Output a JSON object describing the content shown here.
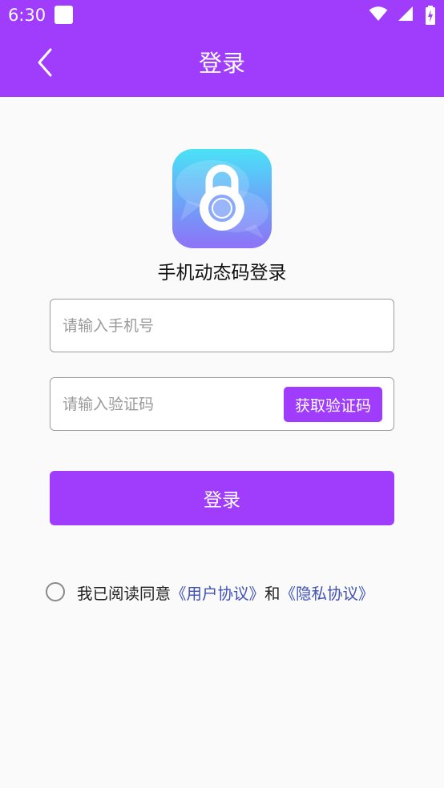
{
  "status_bar": {
    "time": "6:30"
  },
  "nav": {
    "title": "登录"
  },
  "login": {
    "subtitle": "手机动态码登录",
    "phone_placeholder": "请输入手机号",
    "code_placeholder": "请输入验证码",
    "get_code_label": "获取验证码",
    "login_button_label": "登录"
  },
  "agreement": {
    "prefix": "我已阅读同意",
    "user_agreement": "《用户协议》",
    "conjunction": "和",
    "privacy_policy": "《隐私协议》"
  },
  "colors": {
    "accent": "#A03DFC",
    "link": "#3F51B5",
    "background": "#FAFAFA"
  },
  "icons": {
    "back": "chevron-left-icon",
    "logo": "padlock-icon",
    "wifi": "wifi-icon",
    "signal": "signal-icon",
    "battery": "battery-icon"
  }
}
